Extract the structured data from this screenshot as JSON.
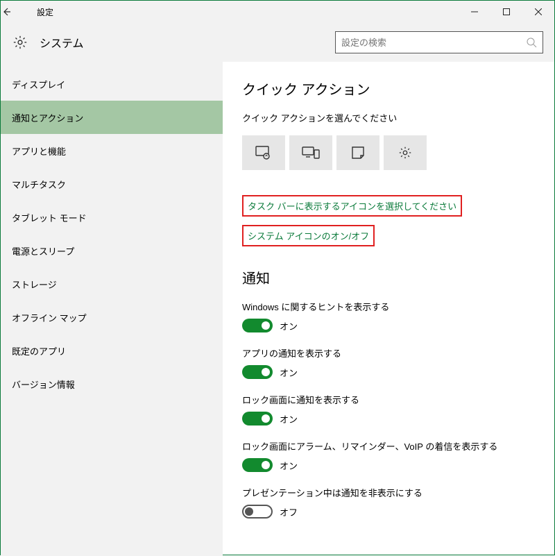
{
  "titlebar": {
    "title": "設定"
  },
  "header": {
    "heading": "システム",
    "search_placeholder": "設定の検索"
  },
  "sidebar": {
    "items": [
      {
        "label": "ディスプレイ"
      },
      {
        "label": "通知とアクション"
      },
      {
        "label": "アプリと機能"
      },
      {
        "label": "マルチタスク"
      },
      {
        "label": "タブレット モード"
      },
      {
        "label": "電源とスリープ"
      },
      {
        "label": "ストレージ"
      },
      {
        "label": "オフライン マップ"
      },
      {
        "label": "既定のアプリ"
      },
      {
        "label": "バージョン情報"
      }
    ],
    "selected_index": 1
  },
  "quick_actions": {
    "title": "クイック アクション",
    "subtitle": "クイック アクションを選んでください",
    "tiles": [
      "tablet-mode-icon",
      "connect-icon",
      "note-icon",
      "all-settings-icon"
    ],
    "link1": "タスク バーに表示するアイコンを選択してください",
    "link2": "システム アイコンのオン/オフ"
  },
  "notifications": {
    "title": "通知",
    "toggles": [
      {
        "label": "Windows に関するヒントを表示する",
        "on": true,
        "state": "オン"
      },
      {
        "label": "アプリの通知を表示する",
        "on": true,
        "state": "オン"
      },
      {
        "label": "ロック画面に通知を表示する",
        "on": true,
        "state": "オン"
      },
      {
        "label": "ロック画面にアラーム、リマインダー、VoIP の着信を表示する",
        "on": true,
        "state": "オン"
      },
      {
        "label": "プレゼンテーション中は通知を非表示にする",
        "on": false,
        "state": "オフ"
      }
    ]
  }
}
